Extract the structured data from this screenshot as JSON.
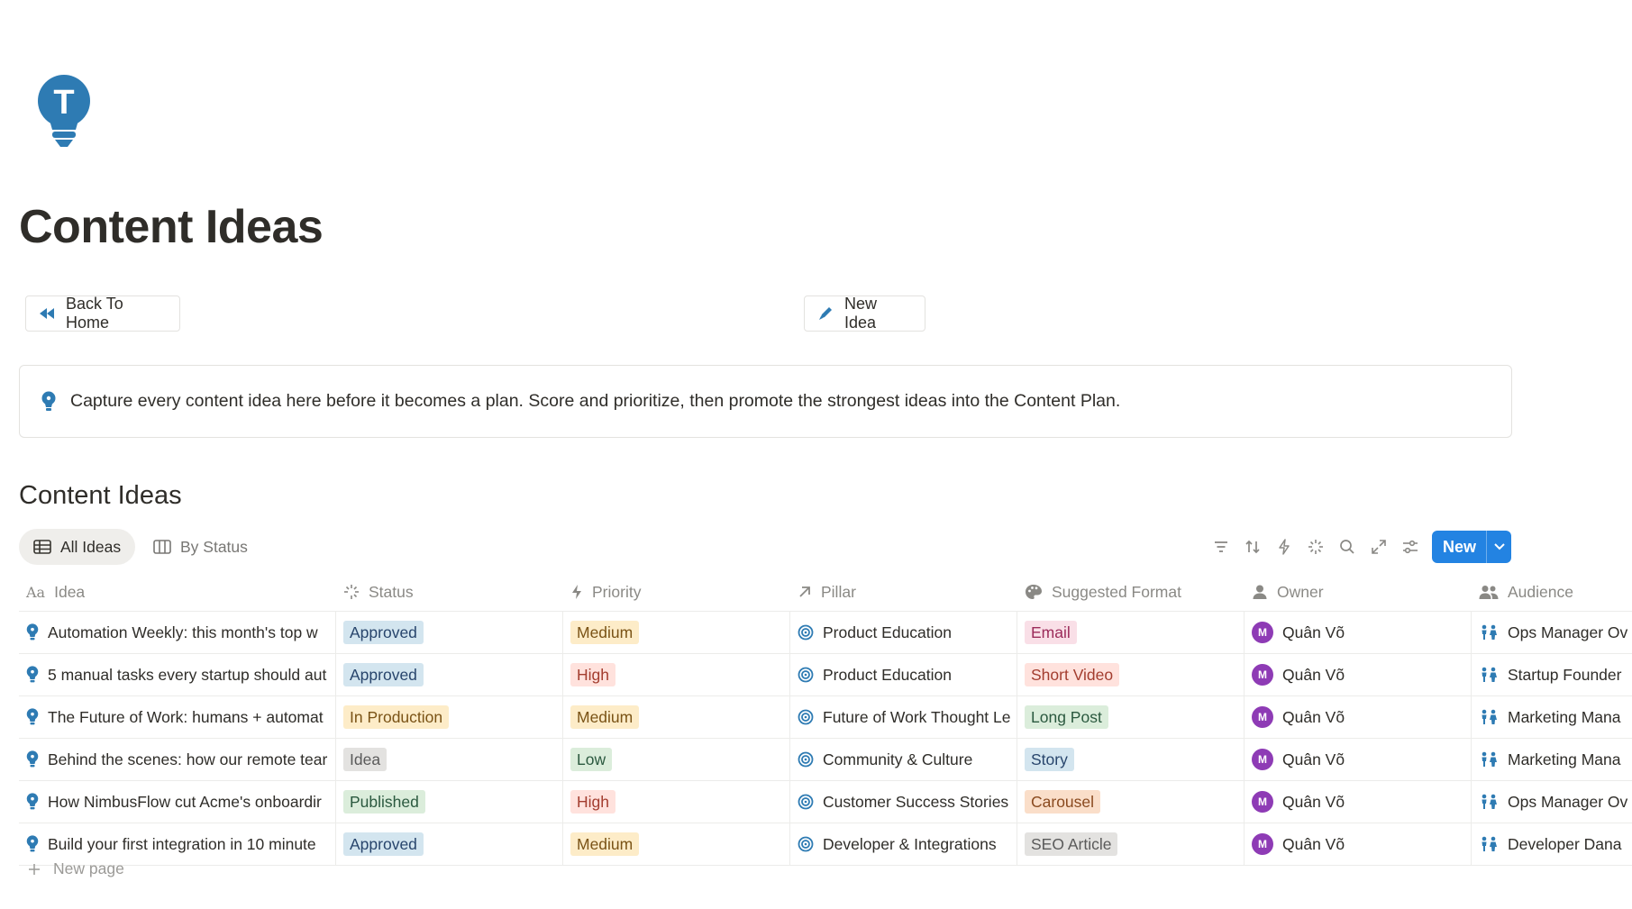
{
  "page": {
    "title": "Content Ideas",
    "icon": "lightbulb-t-icon"
  },
  "buttons": {
    "back_home": "Back To Home",
    "new_idea": "New Idea"
  },
  "callout": {
    "icon": "lightbulb-icon",
    "text": "Capture every content idea here before it becomes a plan. Score and prioritize, then promote the strongest ideas into the Content Plan."
  },
  "database": {
    "title": "Content Ideas",
    "views": [
      {
        "label": "All Ideas",
        "icon": "table-icon",
        "active": true
      },
      {
        "label": "By Status",
        "icon": "board-icon",
        "active": false
      }
    ],
    "toolbar_icons": [
      "filter-icon",
      "sort-icon",
      "automation-icon",
      "ai-sparkle-icon",
      "search-icon",
      "expand-icon",
      "settings-icon"
    ],
    "new_button": "New",
    "columns": [
      {
        "label": "Idea",
        "icon": "title-icon"
      },
      {
        "label": "Status",
        "icon": "status-icon"
      },
      {
        "label": "Priority",
        "icon": "bolt-icon"
      },
      {
        "label": "Pillar",
        "icon": "relation-arrow-icon"
      },
      {
        "label": "Suggested Format",
        "icon": "palette-icon"
      },
      {
        "label": "Owner",
        "icon": "person-icon"
      },
      {
        "label": "Audience",
        "icon": "people-icon"
      }
    ],
    "rows": [
      {
        "idea": "Automation Weekly: this month's top w",
        "status": "Approved",
        "priority": "Medium",
        "pillar": "Product Education",
        "format": "Email",
        "owner": "Quân Võ",
        "owner_initial": "M",
        "audience": "Ops Manager Ov"
      },
      {
        "idea": "5 manual tasks every startup should aut",
        "status": "Approved",
        "priority": "High",
        "pillar": "Product Education",
        "format": "Short Video",
        "owner": "Quân Võ",
        "owner_initial": "M",
        "audience": "Startup Founder"
      },
      {
        "idea": "The Future of Work: humans + automat",
        "status": "In Production",
        "priority": "Medium",
        "pillar": "Future of Work Thought Le",
        "format": "Long Post",
        "owner": "Quân Võ",
        "owner_initial": "M",
        "audience": "Marketing Mana"
      },
      {
        "idea": "Behind the scenes: how our remote tear",
        "status": "Idea",
        "priority": "Low",
        "pillar": "Community & Culture",
        "format": "Story",
        "owner": "Quân Võ",
        "owner_initial": "M",
        "audience": "Marketing Mana"
      },
      {
        "idea": "How NimbusFlow cut Acme's onboardir",
        "status": "Published",
        "priority": "High",
        "pillar": "Customer Success Stories",
        "format": "Carousel",
        "owner": "Quân Võ",
        "owner_initial": "M",
        "audience": "Ops Manager Ov"
      },
      {
        "idea": "Build your first integration in 10 minute",
        "status": "Approved",
        "priority": "Medium",
        "pillar": "Developer & Integrations",
        "format": "SEO Article",
        "owner": "Quân Võ",
        "owner_initial": "M",
        "audience": "Developer Dana"
      }
    ],
    "new_page": "New page"
  },
  "tag_colors": {
    "Approved": {
      "bg": "#d3e5ef",
      "fg": "#28456c"
    },
    "In Production": {
      "bg": "#fdecc8",
      "fg": "#7a5316"
    },
    "Idea": {
      "bg": "#e3e2e0",
      "fg": "#5a5a5a"
    },
    "Published": {
      "bg": "#dbeddb",
      "fg": "#2b593f"
    },
    "Medium": {
      "bg": "#fdecc8",
      "fg": "#7a5316"
    },
    "High": {
      "bg": "#ffe2dd",
      "fg": "#a33d2f"
    },
    "Low": {
      "bg": "#dbeddb",
      "fg": "#2b593f"
    },
    "Email": {
      "bg": "#f9dfe7",
      "fg": "#9c2b5a"
    },
    "Short Video": {
      "bg": "#ffe2dd",
      "fg": "#a33d2f"
    },
    "Long Post": {
      "bg": "#dbeddb",
      "fg": "#2b593f"
    },
    "Story": {
      "bg": "#d3e5ef",
      "fg": "#28456c"
    },
    "Carousel": {
      "bg": "#fadec9",
      "fg": "#8a4a1f"
    },
    "SEO Article": {
      "bg": "#e3e2e0",
      "fg": "#5a5a5a"
    }
  },
  "colors": {
    "accent": "#2383e2",
    "icon_blue": "#2e7bb3"
  }
}
